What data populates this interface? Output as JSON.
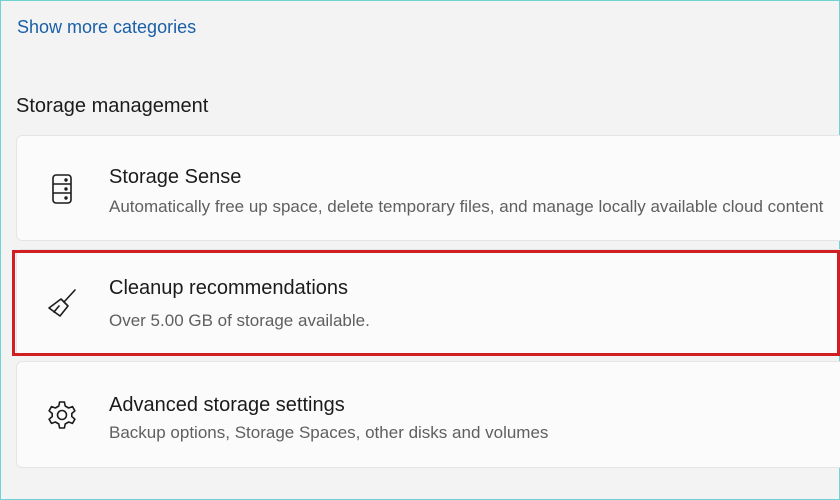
{
  "links": {
    "show_more": "Show more categories"
  },
  "section": {
    "title": "Storage management"
  },
  "items": [
    {
      "title": "Storage Sense",
      "subtitle": "Automatically free up space, delete temporary files, and manage locally available cloud content",
      "icon": "storage-drive-icon"
    },
    {
      "title": "Cleanup recommendations",
      "subtitle": "Over 5.00 GB of storage available.",
      "icon": "broom-icon"
    },
    {
      "title": "Advanced storage settings",
      "subtitle": "Backup options, Storage Spaces, other disks and volumes",
      "icon": "gear-icon"
    }
  ],
  "colors": {
    "link": "#1a5fa8",
    "highlight": "#d01e23",
    "card_background": "#fbfbfb",
    "page_background": "#f3f3f3"
  }
}
